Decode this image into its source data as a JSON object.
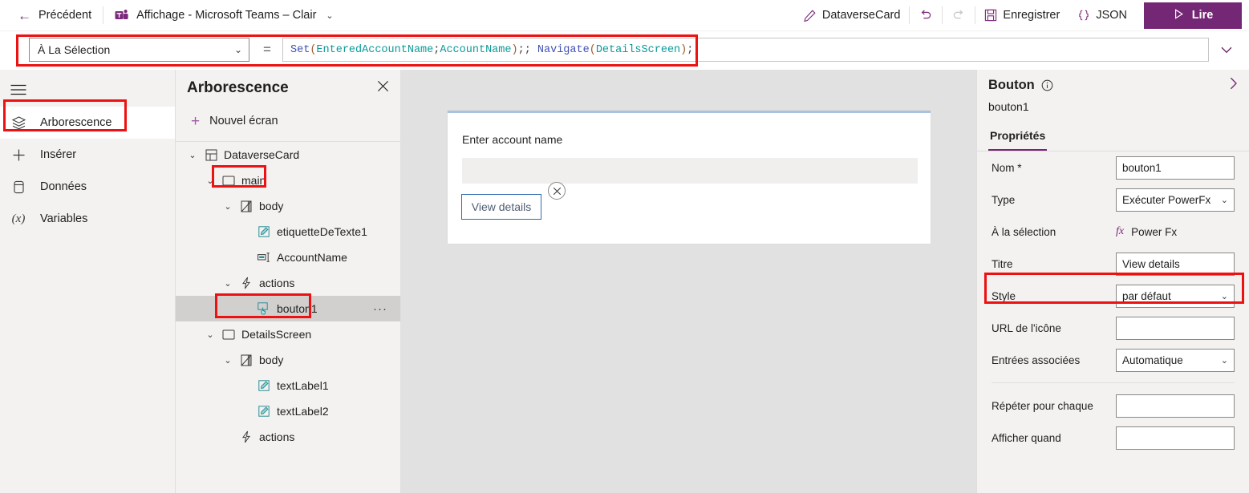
{
  "topbar": {
    "back_label": "Précédent",
    "back_icon": "arrow-left-icon",
    "app_label": "Affichage - Microsoft Teams – Clair",
    "app_icon": "teams-icon",
    "app_chevron": "⌄",
    "edit_label": "DataverseCard",
    "edit_icon": "pencil-icon",
    "undo_icon": "undo-icon",
    "redo_icon": "redo-icon",
    "save_label": "Enregistrer",
    "save_icon": "save-disk-icon",
    "json_label": "JSON",
    "json_icon": "braces-icon",
    "play_label": "Lire",
    "play_icon": "play-triangle-icon"
  },
  "formula_bar": {
    "property_selected": "À La Sélection",
    "property_chevron": "⌄",
    "equals": "=",
    "expand_chevron": "⌄",
    "formula_tokens": [
      {
        "text": "Set",
        "kind": "fn"
      },
      {
        "text": "(",
        "kind": "par"
      },
      {
        "text": "EnteredAccountName",
        "kind": "var"
      },
      {
        "text": ";",
        "kind": "plain"
      },
      {
        "text": "AccountName",
        "kind": "var"
      },
      {
        "text": ")",
        "kind": "par"
      },
      {
        "text": ";; ",
        "kind": "plain"
      },
      {
        "text": "Navigate",
        "kind": "fn"
      },
      {
        "text": "(",
        "kind": "par"
      },
      {
        "text": "DetailsScreen",
        "kind": "var"
      },
      {
        "text": ")",
        "kind": "par"
      },
      {
        "text": ";;",
        "kind": "plain"
      }
    ],
    "formula_plain": "Set(EnteredAccountName;AccountName);; Navigate(DetailsScreen);;"
  },
  "rail": {
    "menu_icon": "hamburger-icon",
    "items": [
      {
        "label": "Arborescence",
        "icon": "layers-icon",
        "active": true
      },
      {
        "label": "Insérer",
        "icon": "plus-icon",
        "active": false
      },
      {
        "label": "Données",
        "icon": "database-icon",
        "active": false
      },
      {
        "label": "Variables",
        "icon": "variable-x-icon",
        "active": false
      }
    ]
  },
  "tree": {
    "title": "Arborescence",
    "close_icon": "close-icon",
    "new_screen_label": "Nouvel écran",
    "new_screen_icon": "plus-icon",
    "nodes": [
      {
        "label": "DataverseCard",
        "icon": "app-grid-icon",
        "depth": 0,
        "twisty": "⌄",
        "selected": false,
        "dots": false
      },
      {
        "label": "main",
        "icon": "screen-icon",
        "depth": 1,
        "twisty": "⌄",
        "selected": false,
        "dots": false
      },
      {
        "label": "body",
        "icon": "container-icon",
        "depth": 2,
        "twisty": "⌄",
        "selected": false,
        "dots": false
      },
      {
        "label": "etiquetteDeTexte1",
        "icon": "label-icon",
        "depth": 3,
        "twisty": "",
        "selected": false,
        "dots": false
      },
      {
        "label": "AccountName",
        "icon": "text-input-icon",
        "depth": 3,
        "twisty": "",
        "selected": false,
        "dots": false
      },
      {
        "label": "actions",
        "icon": "lightning-icon",
        "depth": 2,
        "twisty": "⌄",
        "selected": false,
        "dots": false
      },
      {
        "label": "bouton1",
        "icon": "button-icon",
        "depth": 3,
        "twisty": "",
        "selected": true,
        "dots": true
      },
      {
        "label": "DetailsScreen",
        "icon": "screen-icon",
        "depth": 1,
        "twisty": "⌄",
        "selected": false,
        "dots": false
      },
      {
        "label": "body",
        "icon": "container-icon",
        "depth": 2,
        "twisty": "⌄",
        "selected": false,
        "dots": false
      },
      {
        "label": "textLabel1",
        "icon": "label-icon",
        "depth": 3,
        "twisty": "",
        "selected": false,
        "dots": false
      },
      {
        "label": "textLabel2",
        "icon": "label-icon",
        "depth": 3,
        "twisty": "",
        "selected": false,
        "dots": false
      },
      {
        "label": "actions",
        "icon": "lightning-icon",
        "depth": 2,
        "twisty": "",
        "selected": false,
        "dots": false
      }
    ]
  },
  "canvas": {
    "card_label": "Enter account name",
    "input_value": "",
    "button_label": "View details",
    "delete_handle_icon": "circle-x-icon"
  },
  "properties_panel": {
    "title": "Bouton",
    "info_icon": "info-circle-icon",
    "expand_icon": "chevron-right-icon",
    "subtitle": "bouton1",
    "tab_label": "Propriétés",
    "rows": [
      {
        "label": "Nom *",
        "value": "bouton1",
        "control": "text",
        "highlight": false
      },
      {
        "label": "Type",
        "value": "Exécuter PowerFx",
        "control": "dropdown",
        "highlight": false
      },
      {
        "label": "À la sélection",
        "value": "Power Fx",
        "control": "fx",
        "highlight": false
      },
      {
        "label": "Titre",
        "value": "View details",
        "control": "text",
        "highlight": true
      },
      {
        "label": "Style",
        "value": "par défaut",
        "control": "dropdown",
        "highlight": false
      },
      {
        "label": "URL de l'icône",
        "value": "",
        "control": "text",
        "highlight": false
      },
      {
        "label": "Entrées associées",
        "value": "Automatique",
        "control": "dropdown",
        "highlight": false
      },
      {
        "label": "Répéter pour chaque",
        "value": "",
        "control": "text",
        "highlight": false
      },
      {
        "label": "Afficher quand",
        "value": "",
        "control": "text",
        "highlight": false
      }
    ]
  },
  "colors": {
    "accent_purple": "#742774",
    "annotation_red": "#ee1111",
    "canvas_bg": "#e1e1e1",
    "panel_bg": "#f3f2f1",
    "card_top_border": "#a9c2dd",
    "button_border_blue": "#2f6cb2",
    "selection_gray": "#d2d0ce"
  }
}
